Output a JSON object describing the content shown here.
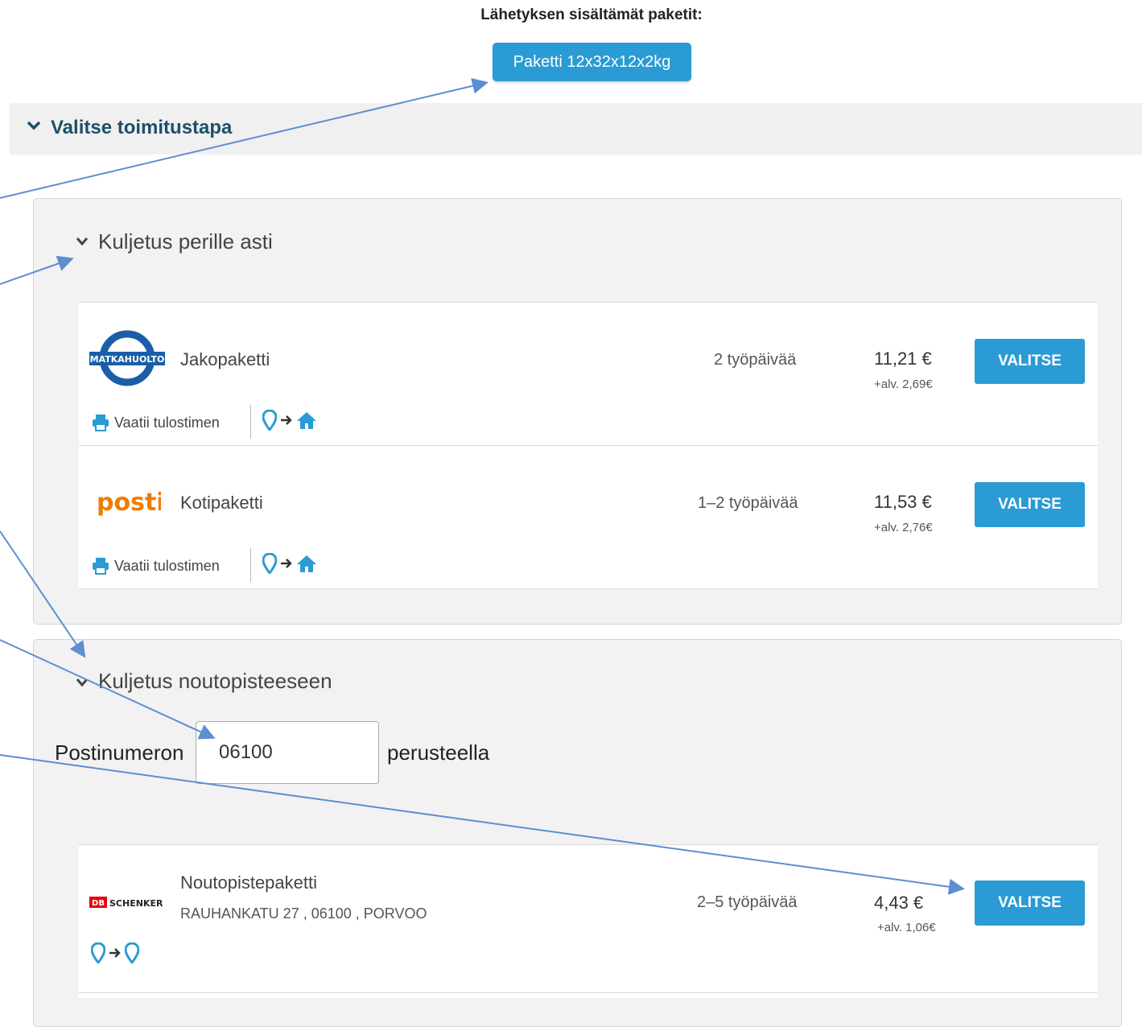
{
  "header": {
    "title": "Lähetyksen sisältämät paketit:",
    "package_label": "Paketti 12x32x12x2kg"
  },
  "section": {
    "label": "Valitse toimitustapa"
  },
  "home_delivery": {
    "heading": "Kuljetus perille asti",
    "options": [
      {
        "carrier": "MATKAHUOLTO",
        "name": "Jakopaketti",
        "days": "2 työpäivää",
        "price": "11,21 €",
        "vat": "+alv. 2,69€",
        "button": "VALITSE",
        "printer": "Vaatii tulostimen"
      },
      {
        "carrier": "posti",
        "name": "Kotipaketti",
        "days": "1–2 työpäivää",
        "price": "11,53 €",
        "vat": "+alv. 2,76€",
        "button": "VALITSE",
        "printer": "Vaatii tulostimen"
      }
    ]
  },
  "pickup_delivery": {
    "heading": "Kuljetus noutopisteeseen",
    "postal_prefix": "Postinumeron",
    "postal_value": "06100",
    "postal_suffix": "perusteella",
    "options": [
      {
        "carrier_db": "DB",
        "carrier": "SCHENKER",
        "name": "Noutopistepaketti",
        "address": "RAUHANKATU 27 , 06100 , PORVOO",
        "days": "2–5 työpäivää",
        "price": "4,43 €",
        "vat": "+alv. 1,06€",
        "button": "VALITSE"
      }
    ]
  },
  "colors": {
    "accent": "#2a9bd4",
    "heading": "#1d4f68",
    "posti": "#f07c00",
    "matkahuolto": "#1a5ea8",
    "schenker": "#e30613"
  }
}
